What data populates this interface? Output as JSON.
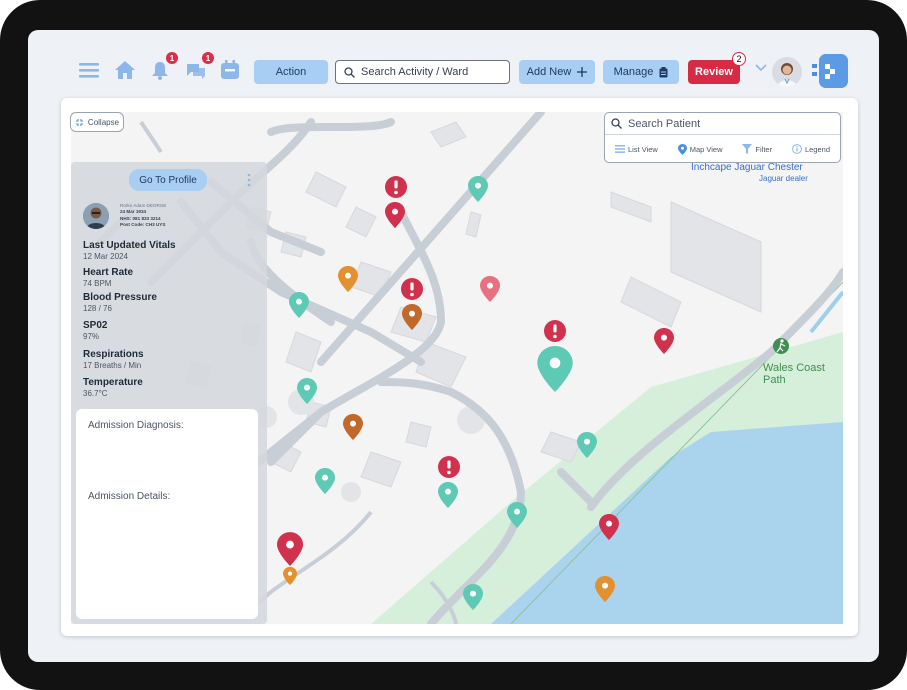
{
  "header": {
    "badges": {
      "alerts": "1",
      "messages": "1"
    },
    "action_label": "Action",
    "search_placeholder": "Search Activity / Ward",
    "add_new_label": "Add New",
    "manage_label": "Manage",
    "review_label": "Review",
    "review_badge": "2"
  },
  "map": {
    "collapse_label": "Collapse",
    "search_patient_placeholder": "Search Patient",
    "views": {
      "list": "List View",
      "map": "Map View",
      "filter": "Filter",
      "legend": "Legend"
    },
    "places": {
      "dealer_name": "Inchcape Jaguar Chester",
      "dealer_sub": "Jaguar dealer",
      "coast_path": "Wales Coast Path"
    }
  },
  "patient": {
    "profile_button": "Go To Profile",
    "name": "Rorko Adam DEORGE",
    "dob": "24 Mar 1934",
    "nhs": "NHS: 081 833 3214",
    "postcode": "Post Code: CH3 UYS",
    "vitals": [
      {
        "label": "Last Updated Vitals",
        "value": "12 Mar 2024"
      },
      {
        "label": "Heart Rate",
        "value": "74 BPM"
      },
      {
        "label": "Blood Pressure",
        "value": "128 / 76"
      },
      {
        "label": "SP02",
        "value": "97%"
      },
      {
        "label": "Respirations",
        "value": "17 Breaths / Min"
      },
      {
        "label": "Temperature",
        "value": "36.7°C"
      }
    ],
    "admission_diagnosis": "Admission Diagnosis:",
    "admission_details": "Admission Details:"
  },
  "colors": {
    "accent": "#a8cef4",
    "review": "#d52b45",
    "pin_red": "#d0314c",
    "pin_teal": "#5ec9b5",
    "pin_orange": "#e3902f",
    "water": "#aad3ee",
    "park": "#d6efdb"
  }
}
